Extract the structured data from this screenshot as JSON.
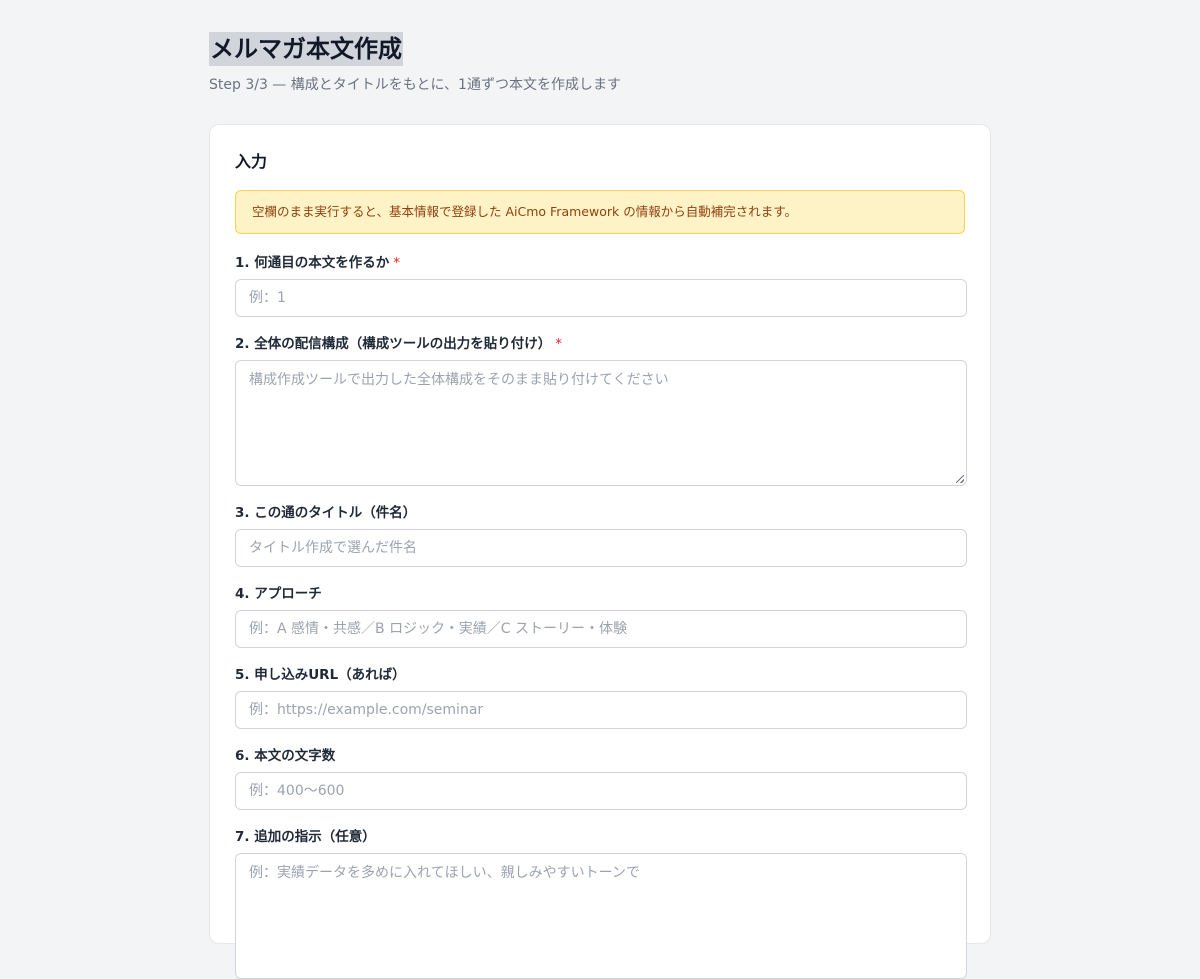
{
  "header": {
    "title": "メルマガ本文作成",
    "subtitle": "Step 3/3 — 構成とタイトルをもとに、1通ずつ本文を作成します"
  },
  "card": {
    "title": "入力",
    "notice": "空欄のまま実行すると、基本情報で登録した AiCmo Framework の情報から自動補完されます。"
  },
  "fields": [
    {
      "label": "1. 何通目の本文を作るか",
      "required": "*",
      "placeholder": "例：1"
    },
    {
      "label": "2. 全体の配信構成（構成ツールの出力を貼り付け）",
      "required": "*",
      "placeholder": "構成作成ツールで出力した全体構成をそのまま貼り付けてください"
    },
    {
      "label": "3. この通のタイトル（件名）",
      "placeholder": "タイトル作成で選んだ件名"
    },
    {
      "label": "4. アプローチ",
      "placeholder": "例：A 感情・共感／B ロジック・実績／C ストーリー・体験"
    },
    {
      "label": "5. 申し込みURL（あれば）",
      "placeholder": "例：https://example.com/seminar"
    },
    {
      "label": "6. 本文の文字数",
      "placeholder": "例：400〜600"
    },
    {
      "label": "7. 追加の指示（任意）",
      "placeholder": "例：実績データを多めに入れてほしい、親しみやすいトーンで"
    }
  ]
}
